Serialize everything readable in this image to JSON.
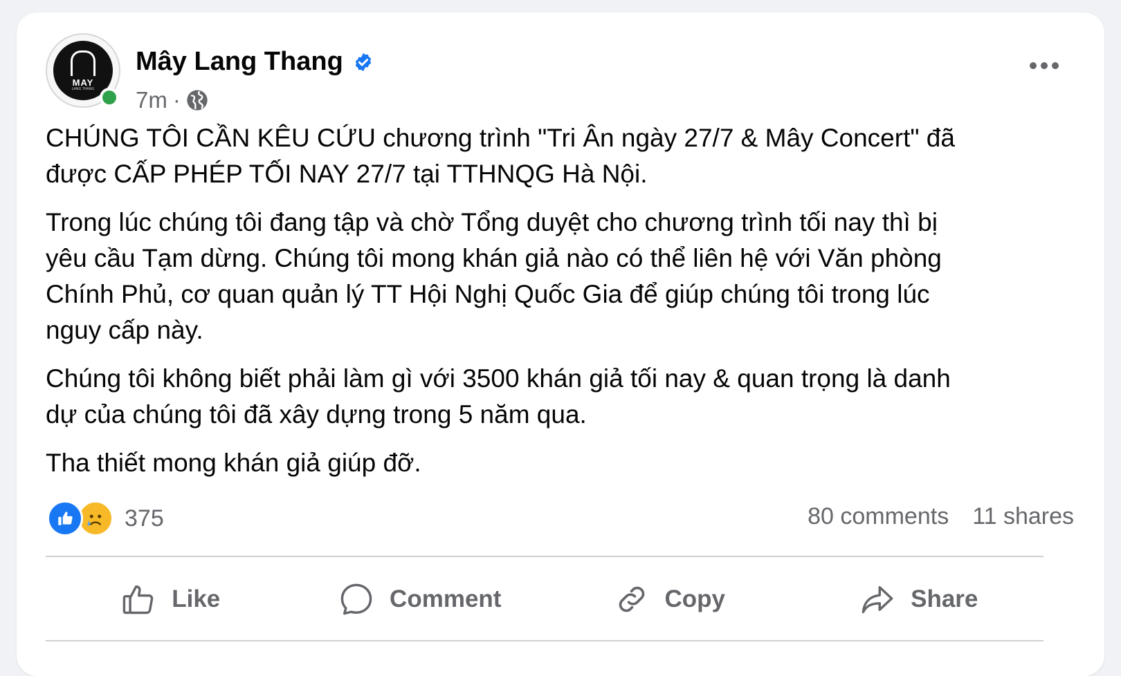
{
  "post": {
    "author": {
      "name": "Mây Lang Thang",
      "avatar_text": "MAY",
      "avatar_sub": "LANG THANG",
      "verified": true
    },
    "time": "7m",
    "meta_separator": "·",
    "privacy_icon": "globe-icon",
    "paragraphs": [
      "CHÚNG TÔI CẦN KÊU CỨU chương trình \"Tri Ân ngày 27/7 & Mây Concert\" đã\nđược CẤP PHÉP TỐI NAY 27/7 tại TTHNQG Hà Nội.",
      "Trong lúc chúng tôi đang tập và chờ Tổng duyệt cho chương trình tối nay thì bị\nyêu cầu Tạm dừng. Chúng tôi mong khán giả nào có thể liên hệ với Văn phòng\nChính Phủ, cơ quan quản lý TT Hội Nghị Quốc Gia để giúp chúng tôi trong lúc\nnguy cấp này.",
      "Chúng tôi không biết phải làm gì với 3500 khán giả tối nay & quan trọng là danh\ndự của chúng tôi đã xây dựng trong 5 năm qua.",
      "Tha thiết mong khán giả giúp đỡ."
    ],
    "reactions": {
      "types": [
        "like",
        "sad"
      ],
      "count": "375"
    },
    "stats": {
      "comments": "80 comments",
      "shares": "11 shares"
    },
    "actions": {
      "like": "Like",
      "comment": "Comment",
      "copy": "Copy",
      "share": "Share"
    }
  },
  "colors": {
    "accent": "#1877f2",
    "secondary_text": "#65676b",
    "online": "#31a24c",
    "sad_reaction": "#f7b928"
  }
}
